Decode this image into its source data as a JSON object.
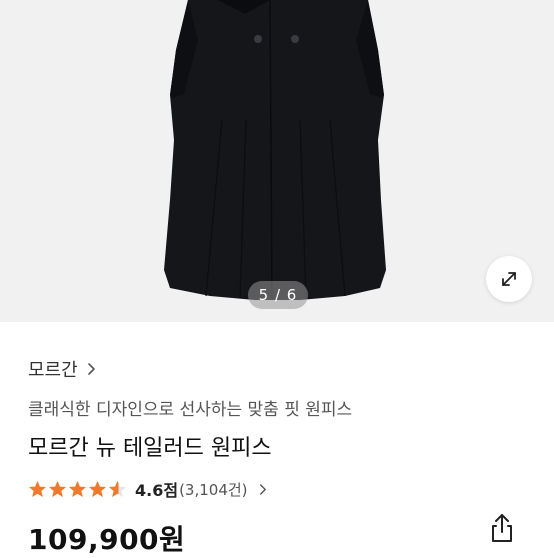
{
  "gallery": {
    "current": 5,
    "total": 6,
    "indicator_text": "5 / 6"
  },
  "product": {
    "brand": "모르간",
    "subtitle": "클래식한 디자인으로 선사하는 맞춤 핏 원피스",
    "title": "모르간 뉴 테일러드 원피스",
    "rating": {
      "stars": 5,
      "filled_stars": 4.5,
      "score": "4.6점",
      "review_count": "(3,104건)"
    },
    "price": "109,900원"
  },
  "colors": {
    "star": "#f07a2b",
    "text_dark": "#111111",
    "text_muted": "#555555",
    "gallery_bg": "#f1f1f1",
    "coat": "#15161a"
  },
  "icons": {
    "brand_chevron": "chevron-right-icon",
    "rating_chevron": "chevron-right-icon",
    "expand": "expand-arrows-icon",
    "share": "share-icon"
  }
}
